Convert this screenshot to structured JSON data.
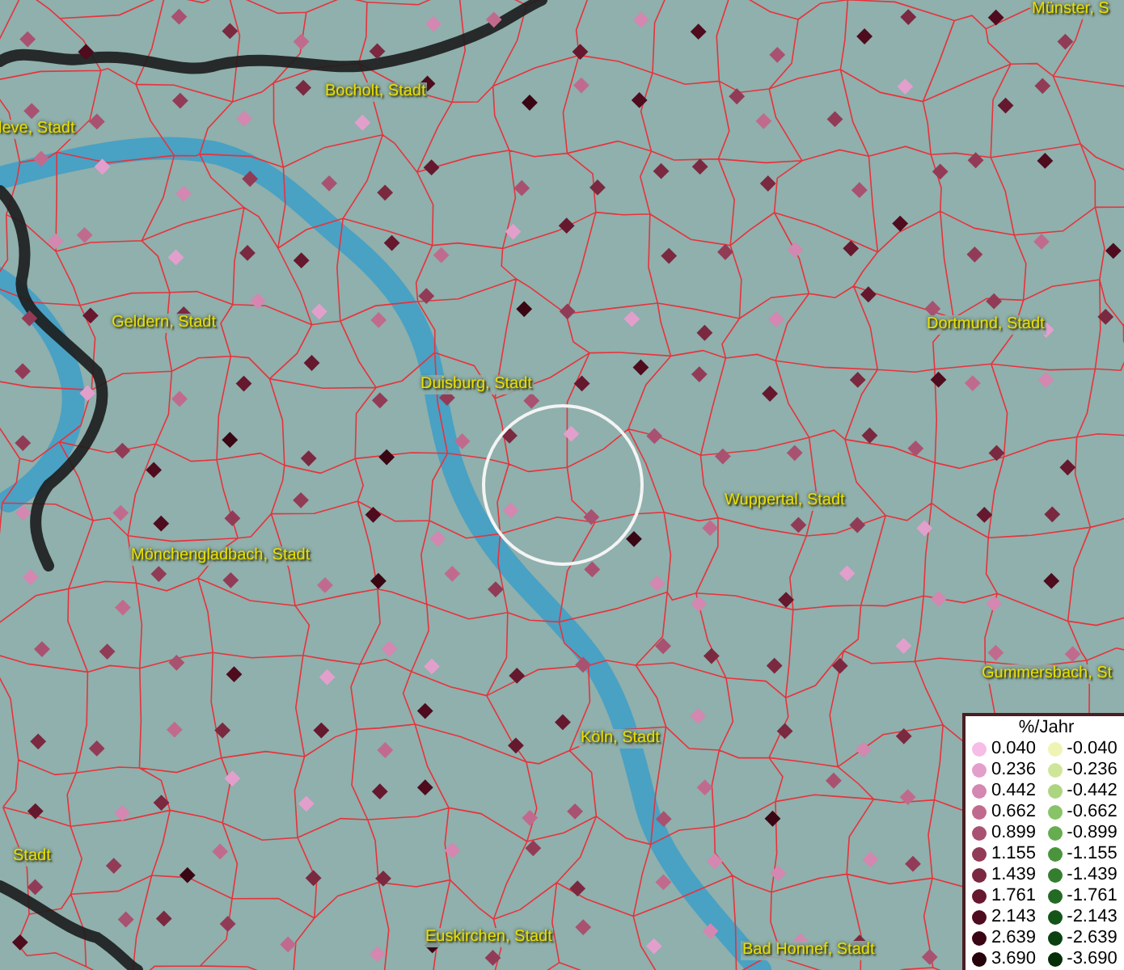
{
  "map": {
    "place_labels": [
      {
        "text": "Münster, S"
      },
      {
        "text": "Bocholt, Stadt"
      },
      {
        "text": "leve, Stadt"
      },
      {
        "text": "Geldern, Stadt"
      },
      {
        "text": "Duisburg, Stadt"
      },
      {
        "text": "Dortmund, Stadt"
      },
      {
        "text": "Wuppertal, Stadt"
      },
      {
        "text": "Mönchengladbach, Stadt"
      },
      {
        "text": "Gummersbach, St"
      },
      {
        "text": "Köln, Stadt"
      },
      {
        "text": "Stadt"
      },
      {
        "text": "Euskirchen, Stadt"
      },
      {
        "text": "Bad Honnef, Stadt"
      }
    ]
  },
  "legend": {
    "title": "%/Jahr",
    "rows": [
      {
        "positive": {
          "value": "0.040",
          "color": "#f6bde6"
        },
        "negative": {
          "value": "-0.040",
          "color": "#eef4b4"
        }
      },
      {
        "positive": {
          "value": "0.236",
          "color": "#e39fcc"
        },
        "negative": {
          "value": "-0.236",
          "color": "#cfe69a"
        }
      },
      {
        "positive": {
          "value": "0.442",
          "color": "#d487b0"
        },
        "negative": {
          "value": "-0.442",
          "color": "#acd580"
        }
      },
      {
        "positive": {
          "value": "0.662",
          "color": "#c06b8e"
        },
        "negative": {
          "value": "-0.662",
          "color": "#88c368"
        }
      },
      {
        "positive": {
          "value": "0.899",
          "color": "#a95170"
        },
        "negative": {
          "value": "-0.899",
          "color": "#66ac50"
        }
      },
      {
        "positive": {
          "value": "1.155",
          "color": "#923b57"
        },
        "negative": {
          "value": "-1.155",
          "color": "#4a943e"
        }
      },
      {
        "positive": {
          "value": "1.439",
          "color": "#7a2940"
        },
        "negative": {
          "value": "-1.439",
          "color": "#357e30"
        }
      },
      {
        "positive": {
          "value": "1.761",
          "color": "#66182e"
        },
        "negative": {
          "value": "-1.761",
          "color": "#236a24"
        }
      },
      {
        "positive": {
          "value": "2.143",
          "color": "#4e0c1e"
        },
        "negative": {
          "value": "-2.143",
          "color": "#145418"
        }
      },
      {
        "positive": {
          "value": "2.639",
          "color": "#3a0614"
        },
        "negative": {
          "value": "-2.639",
          "color": "#0b4010"
        }
      },
      {
        "positive": {
          "value": "3.690",
          "color": "#26020a"
        },
        "negative": {
          "value": "-3.690",
          "color": "#062e08"
        }
      }
    ]
  }
}
